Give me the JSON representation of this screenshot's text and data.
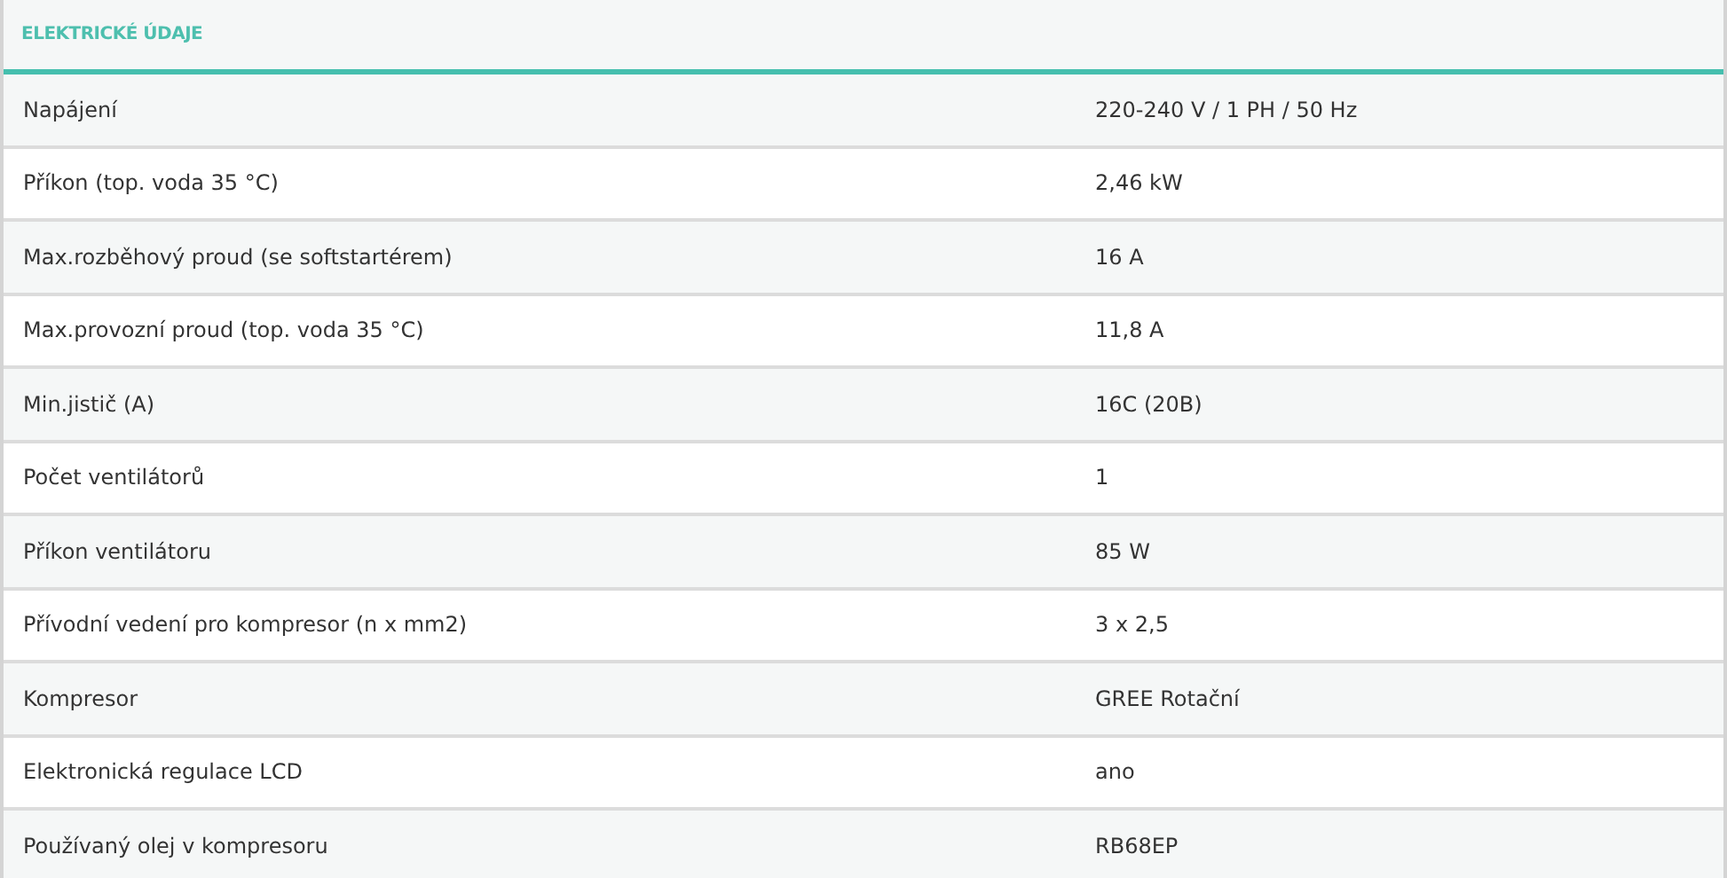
{
  "section_title": "ELEKTRICKÉ ÚDAJE",
  "rows": [
    {
      "label": "Napájení",
      "value": "220-240 V / 1 PH / 50 Hz"
    },
    {
      "label": "Příkon (top. voda 35 °C)",
      "value": "2,46 kW"
    },
    {
      "label": "Max.rozběhový proud (se softstartérem)",
      "value": "16 A"
    },
    {
      "label": "Max.provozní proud (top. voda 35 °C)",
      "value": "11,8 A"
    },
    {
      "label": "Min.jistič (A)",
      "value": "16C (20B)"
    },
    {
      "label": "Počet ventilátorů",
      "value": "1"
    },
    {
      "label": "Příkon ventilátoru",
      "value": "85 W"
    },
    {
      "label": "Přívodní vedení pro kompresor (n x mm2)",
      "value": "3 x 2,5"
    },
    {
      "label": "Kompresor",
      "value": "GREE Rotační"
    },
    {
      "label": "Elektronická regulace LCD",
      "value": "ano"
    },
    {
      "label": "Používaný olej v kompresoru",
      "value": "RB68EP"
    }
  ]
}
